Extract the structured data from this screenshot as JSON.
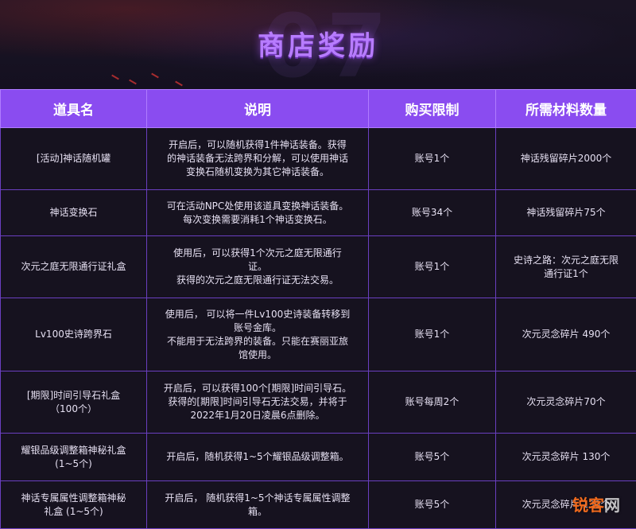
{
  "banner": {
    "title": "商店奖励",
    "bg_number": "07"
  },
  "table": {
    "headers": [
      "道具名",
      "说明",
      "购买限制",
      "所需材料数量"
    ],
    "rows": [
      {
        "name": "[活动]神话随机罐",
        "desc": "开启后，可以随机获得1件神话装备。获得\n的神话装备无法跨界和分解，可以使用神话\n变换石随机变换为其它神话装备。",
        "limit": "账号1个",
        "cost": "神话残留碎片2000个"
      },
      {
        "name": "神话变换石",
        "desc": "可在活动NPC处使用该道具变换神话装备。\n每次变换需要消耗1个神话变换石。",
        "limit": "账号34个",
        "cost": "神话残留碎片75个"
      },
      {
        "name": "次元之庭无限通行证礼盒",
        "desc": "使用后，可以获得1个次元之庭无限通行\n证。\n获得的次元之庭无限通行证无法交易。",
        "limit": "账号1个",
        "cost": "史诗之路：次元之庭无限\n通行证1个"
      },
      {
        "name": "Lv100史诗跨界石",
        "desc": "使用后， 可以将一件Lv100史诗装备转移到\n账号金库。\n不能用于无法跨界的装备。只能在赛丽亚旅\n馆使用。",
        "limit": "账号1个",
        "cost": "次元灵念碎片 490个"
      },
      {
        "name": "[期限]时间引导石礼盒\n（100个）",
        "desc": "开启后，可以获得100个[期限]时间引导石。\n获得的[期限]时间引导石无法交易，并将于\n2022年1月20日凌晨6点删除。",
        "limit": "账号每周2个",
        "cost": "次元灵念碎片70个"
      },
      {
        "name": "耀银品级调整箱神秘礼盒\n(1~5个)",
        "desc": "开启后，随机获得1~5个耀银品级调整箱。",
        "limit": "账号5个",
        "cost": "次元灵念碎片 130个"
      },
      {
        "name": "神话专属属性调整箱神秘\n礼盒 (1~5个)",
        "desc": "开启后， 随机获得1~5个神话专属属性调整\n箱。",
        "limit": "账号5个",
        "cost": "次元灵念碎片 130个"
      }
    ]
  },
  "watermark": {
    "logo_text": "锐客",
    "suffix": "网"
  },
  "colors": {
    "header_bg": "#8a4cf0",
    "border": "#6a3fc0",
    "title": "#b77cff",
    "background": "#141020"
  }
}
